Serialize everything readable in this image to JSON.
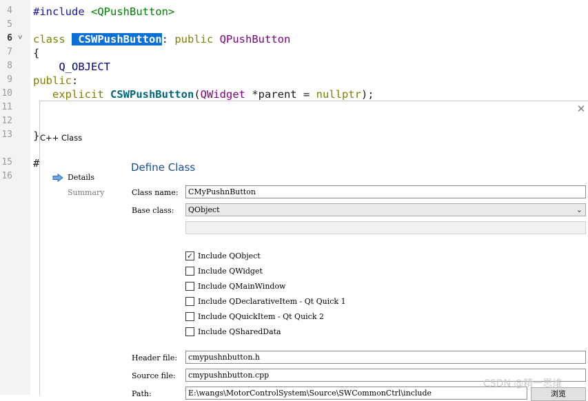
{
  "editor": {
    "line_numbers": [
      "4",
      "5",
      "6",
      "7",
      "8",
      "9",
      "10",
      "11",
      "12",
      "13",
      "15",
      "16"
    ],
    "current_line": "6",
    "fold_marker": "˅",
    "lines": {
      "l4": {
        "a": "#include ",
        "b": "<QPushButton>"
      },
      "l6": {
        "kw": "class",
        "sp": " ",
        "sel": " CSWPushButton",
        "colon": ": ",
        "pub": "public",
        "base": " QPushButton"
      },
      "l7": {
        "t": "{"
      },
      "l8": {
        "t": "    Q_OBJECT"
      },
      "l9": {
        "kw": "public",
        "c": ":"
      },
      "l10": {
        "ind": "   ",
        "kw": "explicit",
        "fn": " CSWPushButton",
        "p1": "(",
        "ty": "QWidget",
        "p2": " *parent = ",
        "np": "nullptr",
        "p3": ");"
      },
      "l13": {
        "t": "}"
      },
      "l15": {
        "t": "#"
      }
    }
  },
  "dialog": {
    "title": "C++ Class",
    "close_symbol": "✕",
    "nav": {
      "details": "Details",
      "summary": "Summary"
    },
    "section_title": "Define Class",
    "class_name": {
      "label": "Class name:",
      "value": "CMyPushnButton"
    },
    "base_class": {
      "label": "Base class:",
      "value": "QObject",
      "dropdown_symbol": "⌄"
    },
    "checkboxes": [
      {
        "label": "Include QObject",
        "checked": "✓"
      },
      {
        "label": "Include QWidget",
        "checked": ""
      },
      {
        "label": "Include QMainWindow",
        "checked": ""
      },
      {
        "label": "Include QDeclarativeItem - Qt Quick 1",
        "checked": ""
      },
      {
        "label": "Include QQuickItem - Qt Quick 2",
        "checked": ""
      },
      {
        "label": "Include QSharedData",
        "checked": ""
      }
    ],
    "header_file": {
      "label": "Header file:",
      "value": "cmypushnbutton.h"
    },
    "source_file": {
      "label": "Source file:",
      "value": "cmypushnbutton.cpp"
    },
    "path": {
      "label": "Path:",
      "value": "E:\\wangs\\MotorControlSystem\\Source\\SWCommonCtrl\\include"
    },
    "browse_label": "浏览"
  },
  "watermark": "CSDN @精一思维",
  "colors": {
    "selection": "#0a70d6",
    "section_title": "#1a4a9c",
    "keyword": "#808000",
    "type": "#800080"
  }
}
